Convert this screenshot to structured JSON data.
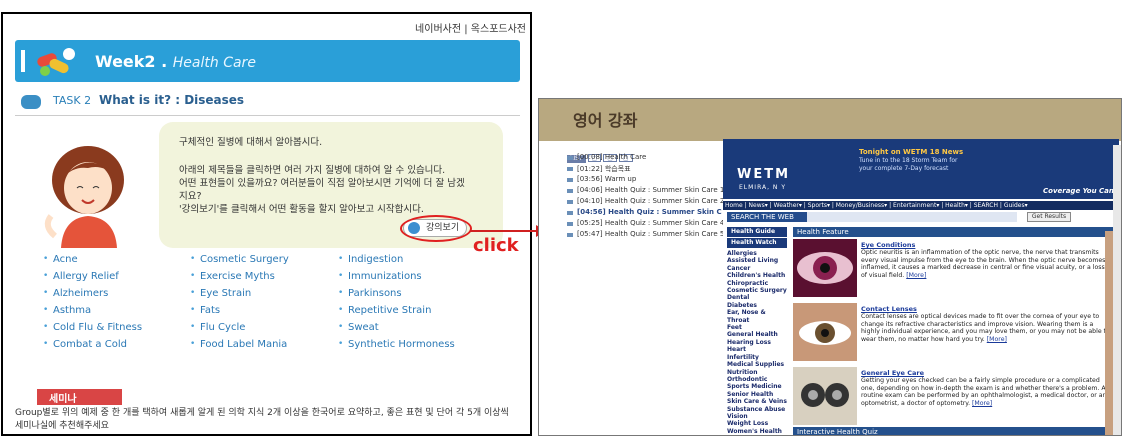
{
  "left_panel": {
    "toplinks": [
      "네이버사전",
      "옥스포드사전"
    ],
    "link_separator": "|",
    "week": {
      "title": "Week2 .",
      "subtitle": "Health Care"
    },
    "task": {
      "number": "TASK 2",
      "title": "What is it? : Diseases"
    },
    "bubble": {
      "line1": "구체적인 질병에 대해서 알아봅시다.",
      "line2": "아래의 제목들을 클릭하면 여러 가지 질병에 대하여 알 수 있습니다.",
      "line3": "어떤 표현들이 있을까요? 여러분들이 직접 알아보시면 기억에 더 잘 남겠",
      "line4": "지요?",
      "line5": "'강의보기'를 클릭해서 어떤 활동을 할지 알아보고 시작합시다."
    },
    "lecture_button": "강의보기",
    "click_label": "click",
    "topics": {
      "col1": [
        "Acne",
        "Allergy Relief",
        "Alzheimers",
        "Asthma",
        "Cold Flu & Fitness",
        "Combat a Cold"
      ],
      "col2": [
        "Cosmetic Surgery",
        "Exercise Myths",
        "Eye Strain",
        "Fats",
        "Flu Cycle",
        "Food Label Mania"
      ],
      "col3": [
        "Indigestion",
        "Immunizations",
        "Parkinsons",
        "Repetitive Strain",
        "Sweat",
        "Synthetic Hormoness"
      ]
    },
    "seminar": {
      "label": "세미나",
      "text": "Group별로 위의 예제 중 한 개를 택하여 새롭게 알게 된 의학 지식 2개 이상을 한국어로 요약하고, 좋은 표현 및 단어 각 5개 이상씩 세미나실에 추천해주세요"
    }
  },
  "right_panel": {
    "title": "영어 강좌",
    "list_tabs": [
      "LIST",
      "",
      "",
      ""
    ],
    "chapters": [
      "[00:08] Health Care",
      "[01:22] 학습목표",
      "[03:56] Warm up",
      "[04:06] Health Quiz : Summer Skin Care 1",
      "[04:10] Health Quiz : Summer Skin Care 2",
      "[04:56] Health Quiz : Summer Skin C",
      "[05:25] Health Quiz : Summer Skin Care 4",
      "[05:47] Health Quiz : Summer Skin Care 5"
    ],
    "site": {
      "logo": "WETM",
      "location": "ELMIRA, N Y",
      "tonight": "Tonight on WETM 18 News",
      "tune": "Tune in to the 18 Storm Team for your complete 7-Day forecast",
      "coverage": "Coverage You Can",
      "nav": "Home | News▾ | Weather▾ | Sports▾ | Money/Business▾ | Entertainment▾ | Health▾ | SEARCH | Guides▾",
      "search_label": "SEARCH THE WEB",
      "get_results": "Get Results",
      "health_guide": "Health Guide",
      "health_watch": "Health Watch",
      "guide_list": [
        "Allergies",
        "Assisted Living",
        "Cancer",
        "Children's Health",
        "Chiropractic",
        "Cosmetic Surgery",
        "Dental",
        "Diabetes",
        "Ear, Nose & Throat",
        "Feet",
        "General Health",
        "Hearing Loss",
        "Heart",
        "Infertility",
        "Medical Supplies",
        "Nutrition",
        "Orthodontic",
        "Sports Medicine",
        "Senior Health",
        "Skin Care & Veins",
        "Substance Abuse",
        "Vision",
        "Weight Loss",
        "Women's Health"
      ],
      "feature_header": "Health Feature",
      "articles": [
        {
          "title": "Eye Conditions",
          "body": "Optic neuritis is an inflammation of the optic nerve, the nerve that transmits every visual impulse from the eye to the brain. When the optic nerve becomes inflamed, it causes a marked decrease in central or fine visual acuity, or a loss of visual field.",
          "more": "[More]"
        },
        {
          "title": "Contact Lenses",
          "body": "Contact lenses are optical devices made to fit over the cornea of your eye to change its refractive characteristics and improve vision. Wearing them is a highly individual experience, and you may love them, or you may not be able to wear them, no matter how hard you try.",
          "more": "[More]"
        },
        {
          "title": "General Eye Care",
          "body": "Getting your eyes checked can be a fairly simple procedure or a complicated one, depending on how in-depth the exam is and whether there's a problem. A routine exam can be performed by an ophthalmologist, a medical doctor, or an optometrist, a doctor of optometry.",
          "more": "[More]"
        }
      ],
      "quiz_header": "Interactive Health Quiz"
    }
  }
}
